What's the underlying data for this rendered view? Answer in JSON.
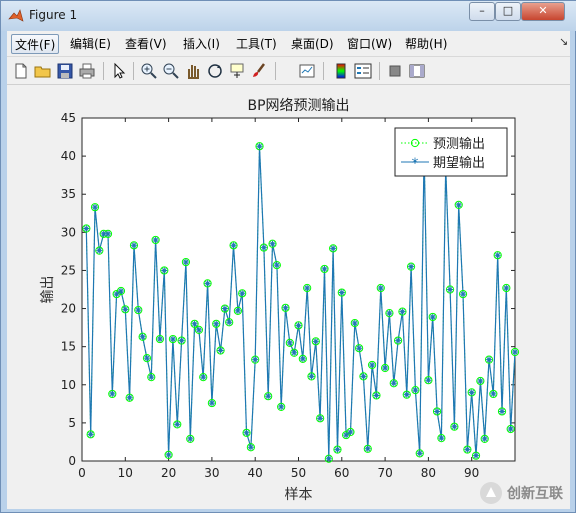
{
  "window": {
    "title": "Figure 1",
    "minimize_glyph": "–",
    "maximize_glyph": "□",
    "close_glyph": "✕",
    "app_icon": "matlab-icon"
  },
  "menubar": {
    "items": [
      "文件(F)",
      "编辑(E)",
      "查看(V)",
      "插入(I)",
      "工具(T)",
      "桌面(D)",
      "窗口(W)",
      "帮助(H)"
    ],
    "overflow_glyph": "↘"
  },
  "toolbar": {
    "icons": [
      "new-figure-icon",
      "open-file-icon",
      "save-icon",
      "print-icon",
      "pointer-icon",
      "zoom-in-icon",
      "zoom-out-icon",
      "pan-icon",
      "rotate-3d-icon",
      "data-cursor-icon",
      "brush-icon",
      "link-plot-icon",
      "colorbar-icon",
      "legend-icon",
      "hide-plot-tools-icon",
      "show-plot-tools-icon"
    ]
  },
  "chart_data": {
    "type": "line",
    "title": "BP网络预测输出",
    "xlabel": "样本",
    "ylabel": "输出",
    "xlim": [
      0,
      100
    ],
    "ylim": [
      0,
      45
    ],
    "xticks": [
      0,
      10,
      20,
      30,
      40,
      50,
      60,
      70,
      80,
      90
    ],
    "yticks": [
      0,
      5,
      10,
      15,
      20,
      25,
      30,
      35,
      40,
      45
    ],
    "grid": false,
    "legend_location": "top-right",
    "series": [
      {
        "name": "预测输出",
        "style": "dotted line with circle markers",
        "color": "#00ff00",
        "values": [
          30.5,
          3.5,
          33.3,
          27.6,
          29.8,
          29.8,
          8.8,
          21.9,
          22.3,
          19.9,
          8.3,
          28.3,
          19.8,
          16.3,
          13.5,
          11.0,
          29.0,
          16.0,
          25.0,
          0.8,
          16.0,
          4.8,
          15.8,
          26.1,
          2.9,
          18.0,
          17.2,
          11.0,
          23.3,
          7.6,
          18.0,
          14.5,
          20.0,
          18.2,
          28.3,
          19.7,
          22.0,
          3.7,
          1.8,
          13.3,
          41.3,
          28.0,
          8.5,
          28.5,
          25.7,
          7.1,
          20.1,
          15.5,
          14.2,
          17.8,
          13.4,
          22.7,
          11.1,
          15.7,
          5.6,
          25.2,
          0.3,
          27.9,
          1.5,
          22.1,
          3.4,
          3.8,
          18.1,
          14.8,
          11.1,
          1.6,
          12.6,
          8.6,
          22.7,
          12.2,
          19.4,
          10.2,
          15.8,
          19.6,
          8.7,
          25.5,
          9.3,
          1.0,
          40.5,
          10.6,
          18.9,
          6.5,
          3.0,
          38.5,
          22.5,
          4.5,
          33.6,
          21.9,
          1.5,
          9.0,
          0.7,
          10.5,
          2.9,
          13.3,
          8.8,
          27.0,
          6.5,
          22.7,
          4.2,
          14.3
        ]
      },
      {
        "name": "期望输出",
        "style": "solid line with star markers",
        "color": "#1f77b4",
        "values": [
          30.5,
          3.5,
          33.3,
          27.6,
          29.8,
          29.8,
          8.8,
          21.9,
          22.3,
          19.9,
          8.3,
          28.3,
          19.8,
          16.3,
          13.5,
          11.0,
          29.0,
          16.0,
          25.0,
          0.8,
          16.0,
          4.8,
          15.8,
          26.1,
          2.9,
          18.0,
          17.2,
          11.0,
          23.3,
          7.6,
          18.0,
          14.5,
          20.0,
          18.2,
          28.3,
          19.7,
          22.0,
          3.7,
          1.8,
          13.3,
          41.3,
          28.0,
          8.5,
          28.5,
          25.7,
          7.1,
          20.1,
          15.5,
          14.2,
          17.8,
          13.4,
          22.7,
          11.1,
          15.7,
          5.6,
          25.2,
          0.3,
          27.9,
          1.5,
          22.1,
          3.4,
          3.8,
          18.1,
          14.8,
          11.1,
          1.6,
          12.6,
          8.6,
          22.7,
          12.2,
          19.4,
          10.2,
          15.8,
          19.6,
          8.7,
          25.5,
          9.3,
          1.0,
          40.5,
          10.6,
          18.9,
          6.5,
          3.0,
          38.5,
          22.5,
          4.5,
          33.6,
          21.9,
          1.5,
          9.0,
          0.7,
          10.5,
          2.9,
          13.3,
          8.8,
          27.0,
          6.5,
          22.7,
          4.2,
          14.3
        ]
      }
    ]
  },
  "watermark": {
    "text": "创新互联",
    "icon": "brand-logo-icon"
  }
}
